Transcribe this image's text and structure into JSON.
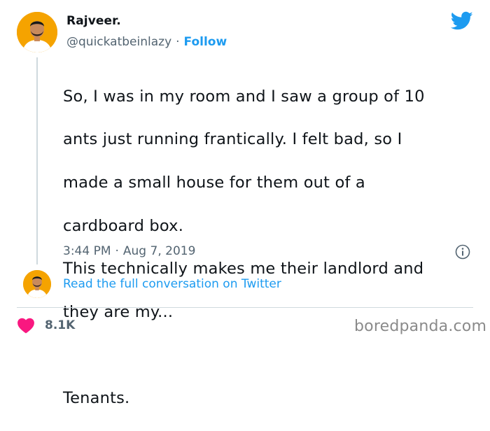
{
  "author": {
    "name": "Rajveer.",
    "handle": "@quickatbeinlazy",
    "separator": "·",
    "follow_label": "Follow"
  },
  "tweet": {
    "lines": [
      "So, I was in my room and I saw a group of 10",
      "ants just running frantically. I felt bad, so I",
      "made a small house for them out of a",
      "cardboard box.",
      "This technically makes me their landlord and",
      "they are my...",
      "",
      "Tenants."
    ],
    "time": "3:44 PM",
    "separator": "·",
    "date": "Aug 7, 2019"
  },
  "read_full_label": "Read the full conversation on Twitter",
  "likes_count": "8.1K",
  "watermark": "boredpanda.com",
  "colors": {
    "accent": "#1d9bf0",
    "heart": "#f91880",
    "avatar_bg": "#f5a300",
    "muted_text": "#536471"
  },
  "icons": [
    "twitter-bird-icon",
    "info-icon",
    "heart-icon"
  ]
}
